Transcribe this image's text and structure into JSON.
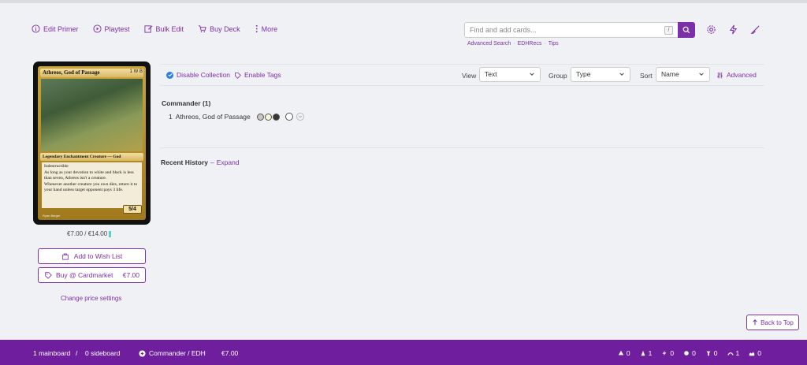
{
  "toolbar": {
    "edit_primer": "Edit Primer",
    "playtest": "Playtest",
    "bulk_edit": "Bulk Edit",
    "buy_deck": "Buy Deck",
    "more": "More"
  },
  "search": {
    "placeholder": "Find and add cards...",
    "shortcut": "/",
    "links": [
      "Advanced Search",
      "EDHRecs",
      "Tips"
    ]
  },
  "card": {
    "name": "Athreos, God of Passage",
    "mana": "1 W B",
    "type_line": "Legendary Enchantment Creature — God",
    "rules": [
      "Indestructible",
      "As long as your devotion to white and black is less than seven, Athreos isn't a creature.",
      "Whenever another creature you own dies, return it to your hand unless target opponent pays 3 life."
    ],
    "pt": "5/4",
    "artist": "Ryan Barger",
    "price": "€7.00 / €14.00"
  },
  "sidebar": {
    "wish_list": "Add to Wish List",
    "buy_label": "Buy @ Cardmarket",
    "buy_price": "€7.00",
    "price_settings": "Change price settings"
  },
  "deck_controls": {
    "disable_collection": "Disable Collection",
    "enable_tags": "Enable Tags",
    "view_label": "View",
    "view_value": "Text",
    "group_label": "Group",
    "group_value": "Type",
    "sort_label": "Sort",
    "sort_value": "Name",
    "advanced": "Advanced"
  },
  "deck": {
    "section_title": "Commander (1)",
    "cards": [
      {
        "qty": "1",
        "name": "Athreos, God of Passage"
      }
    ]
  },
  "history": {
    "title": "Recent History",
    "expand": "Expand"
  },
  "back_to_top": "Back to Top",
  "footer": {
    "mainboard": "1 mainboard",
    "divider": "/",
    "sideboard": "0 sideboard",
    "format": "Commander / EDH",
    "price": "€7.00",
    "stats": [
      "0",
      "1",
      "0",
      "0",
      "0",
      "1",
      "0"
    ]
  },
  "colors": {
    "accent": "#7b2fa8",
    "footer_bg": "#6f1f9e",
    "check_blue": "#2b7de9"
  }
}
